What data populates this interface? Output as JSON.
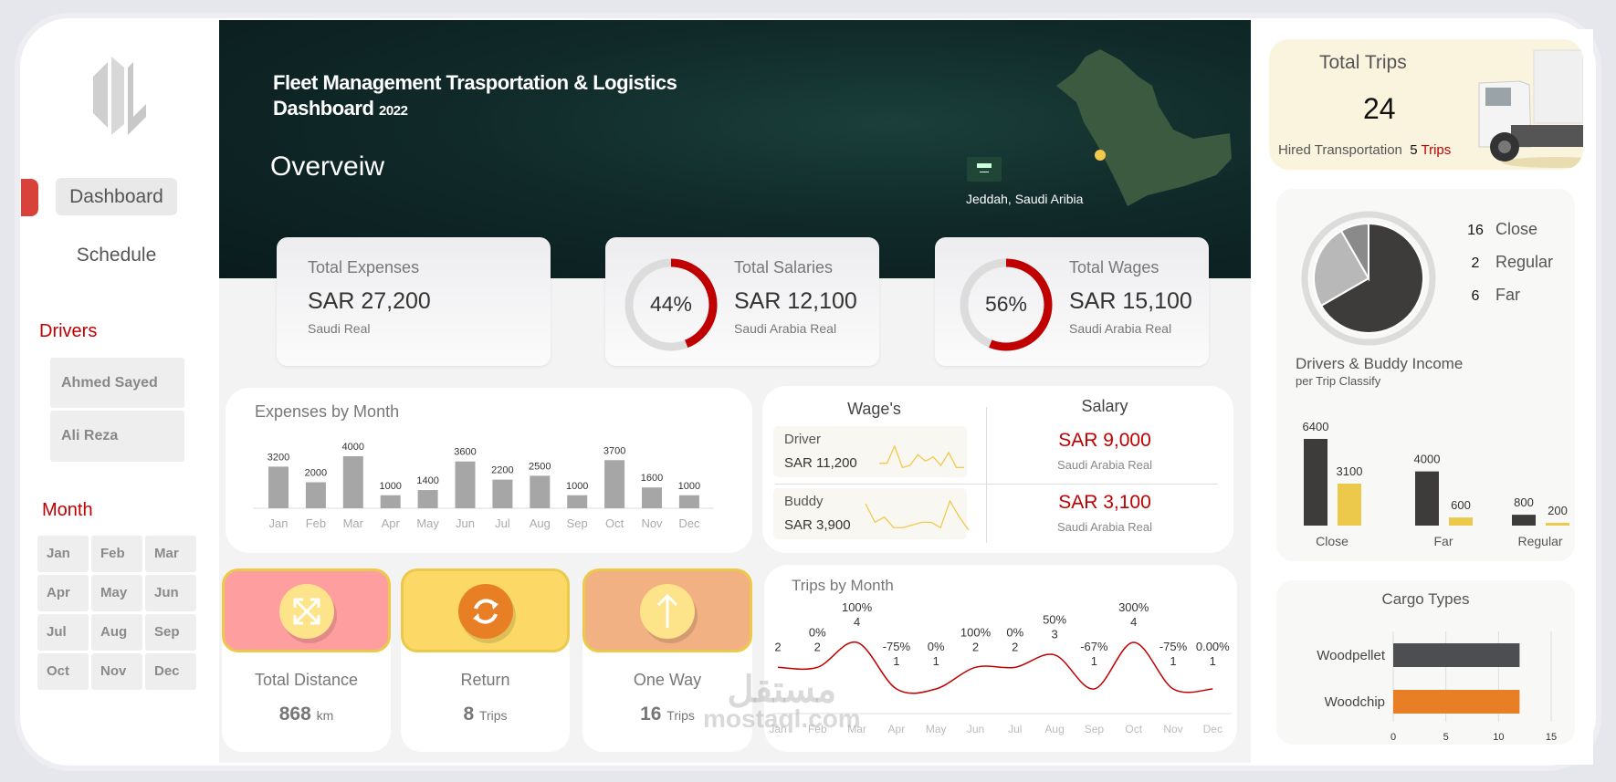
{
  "sidebar": {
    "logo_text": "DL",
    "nav": [
      {
        "label": "Dashboard",
        "active": true
      },
      {
        "label": "Schedule",
        "active": false
      }
    ],
    "drivers_label": "Drivers",
    "drivers": [
      "Ahmed Sayed",
      "Ali Reza"
    ],
    "month_label": "Month",
    "months": [
      "Jan",
      "Feb",
      "Mar",
      "Apr",
      "May",
      "Jun",
      "Jul",
      "Aug",
      "Sep",
      "Oct",
      "Nov",
      "Dec"
    ]
  },
  "header": {
    "title_line1": "Fleet Management Trasportation & Logistics",
    "title_line2": "Dashboard",
    "year": "2022",
    "section": "Overveiw",
    "location": "Jeddah, Saudi Aribia"
  },
  "kpis": [
    {
      "title": "Total Expenses",
      "value": "SAR 27,200",
      "sub": "Saudi Real"
    },
    {
      "title": "Total Salaries",
      "value": "SAR 12,100",
      "sub": "Saudi Arabia Real",
      "percent_label": "44%",
      "percent": 44
    },
    {
      "title": "Total Wages",
      "value": "SAR 15,100",
      "sub": "Saudi Arabia Real",
      "percent_label": "56%",
      "percent": 56
    }
  ],
  "wages": {
    "title": "Wage's",
    "rows": [
      {
        "label": "Driver",
        "value": "SAR 11,200",
        "spark": [
          2,
          2,
          6,
          1,
          1.5,
          4,
          2.5,
          3.5,
          1.5,
          4.5,
          1,
          1
        ]
      },
      {
        "label": "Buddy",
        "value": "SAR 3,900",
        "spark": [
          6,
          2.5,
          3.5,
          1.5,
          1.5,
          2,
          2.5,
          2.5,
          1.5,
          6.5,
          3.5,
          1
        ]
      }
    ]
  },
  "salary": {
    "title": "Salary",
    "rows": [
      {
        "value": "SAR 9,000",
        "sub": "Saudi Arabia Real"
      },
      {
        "value": "SAR 3,100",
        "sub": "Saudi Arabia Real"
      }
    ]
  },
  "summary_cards": [
    {
      "label": "Total Distance",
      "value": "868",
      "unit": "km",
      "icon": "expand-arrows-icon",
      "color": "#ff9e9e"
    },
    {
      "label": "Return",
      "value": "8",
      "unit": "Trips",
      "icon": "refresh-icon",
      "color": "#fcd966"
    },
    {
      "label": "One Way",
      "value": "16",
      "unit": "Trips",
      "icon": "arrow-up-icon",
      "color": "#f2b183"
    }
  ],
  "total_trips": {
    "title": "Total Trips",
    "value": "24",
    "hired_label": "Hired Transportation",
    "hired_value": "5",
    "hired_unit": "Trips"
  },
  "watermark": {
    "arabic": "مستقل",
    "latin": "mostaql.com"
  },
  "colors": {
    "accent_red": "#c00000",
    "dark": "#3d3c3b",
    "yellow": "#ecc94b",
    "orange": "#e87f24"
  },
  "chart_data": [
    {
      "type": "bar",
      "title": "Expenses by Month",
      "categories": [
        "Jan",
        "Feb",
        "Mar",
        "Apr",
        "May",
        "Jun",
        "Jul",
        "Aug",
        "Sep",
        "Oct",
        "Nov",
        "Dec"
      ],
      "values": [
        3200,
        2000,
        4000,
        1000,
        1400,
        3600,
        2200,
        2500,
        1000,
        3700,
        1600,
        1000
      ],
      "data_labels": [
        "3200",
        "2000",
        "4000",
        "1000",
        "1400",
        "3600",
        "2200",
        "2500",
        "1000",
        "3700",
        "1600",
        "1000"
      ]
    },
    {
      "type": "line",
      "title": "Trips by Month",
      "categories": [
        "Jan",
        "Feb",
        "Mar",
        "Apr",
        "May",
        "Jun",
        "Jul",
        "Aug",
        "Sep",
        "Oct",
        "Nov",
        "Dec"
      ],
      "values": [
        2,
        2,
        4,
        1,
        1,
        2,
        2,
        3,
        1,
        4,
        1,
        1
      ],
      "value_labels": [
        "2",
        "2",
        "4",
        "1",
        "1",
        "2",
        "2",
        "3",
        "1",
        "4",
        "1",
        "1"
      ],
      "change_labels": [
        "",
        "0%",
        "100%",
        "-75%",
        "0%",
        "100%",
        "0%",
        "50%",
        "-67%",
        "300%",
        "-75%",
        "0.00%"
      ],
      "color": "#c00000"
    },
    {
      "type": "pie",
      "slices": [
        {
          "label": "Close",
          "value": 16,
          "value_label": "16",
          "color": "#3d3c3b"
        },
        {
          "label": "Far",
          "value": 6,
          "value_label": "6",
          "color": "#b8b8b8"
        },
        {
          "label": "Regular",
          "value": 2,
          "value_label": "2",
          "color": "#8a8a8a"
        }
      ],
      "legend_order": [
        "Close",
        "Regular",
        "Far"
      ]
    },
    {
      "type": "bar",
      "title": "Drivers & Buddy Income",
      "subtitle": "per Trip Classify",
      "categories": [
        "Close",
        "Far",
        "Regular"
      ],
      "series": [
        {
          "values": [
            6400,
            4000,
            800
          ],
          "labels": [
            "6400",
            "4000",
            "800"
          ],
          "color": "#3d3c3b"
        },
        {
          "values": [
            3100,
            600,
            200
          ],
          "labels": [
            "3100",
            "600",
            "200"
          ],
          "color": "#ecc94b"
        }
      ]
    },
    {
      "type": "bar",
      "orientation": "horizontal",
      "title": "Cargo Types",
      "categories": [
        "Woodpellet",
        "Woodchip"
      ],
      "values": [
        12,
        12
      ],
      "colors": [
        "#4d4e52",
        "#e87f24"
      ],
      "xlim": [
        0,
        15
      ],
      "ticks": [
        "0",
        "5",
        "10",
        "15"
      ],
      "grid": true
    }
  ]
}
